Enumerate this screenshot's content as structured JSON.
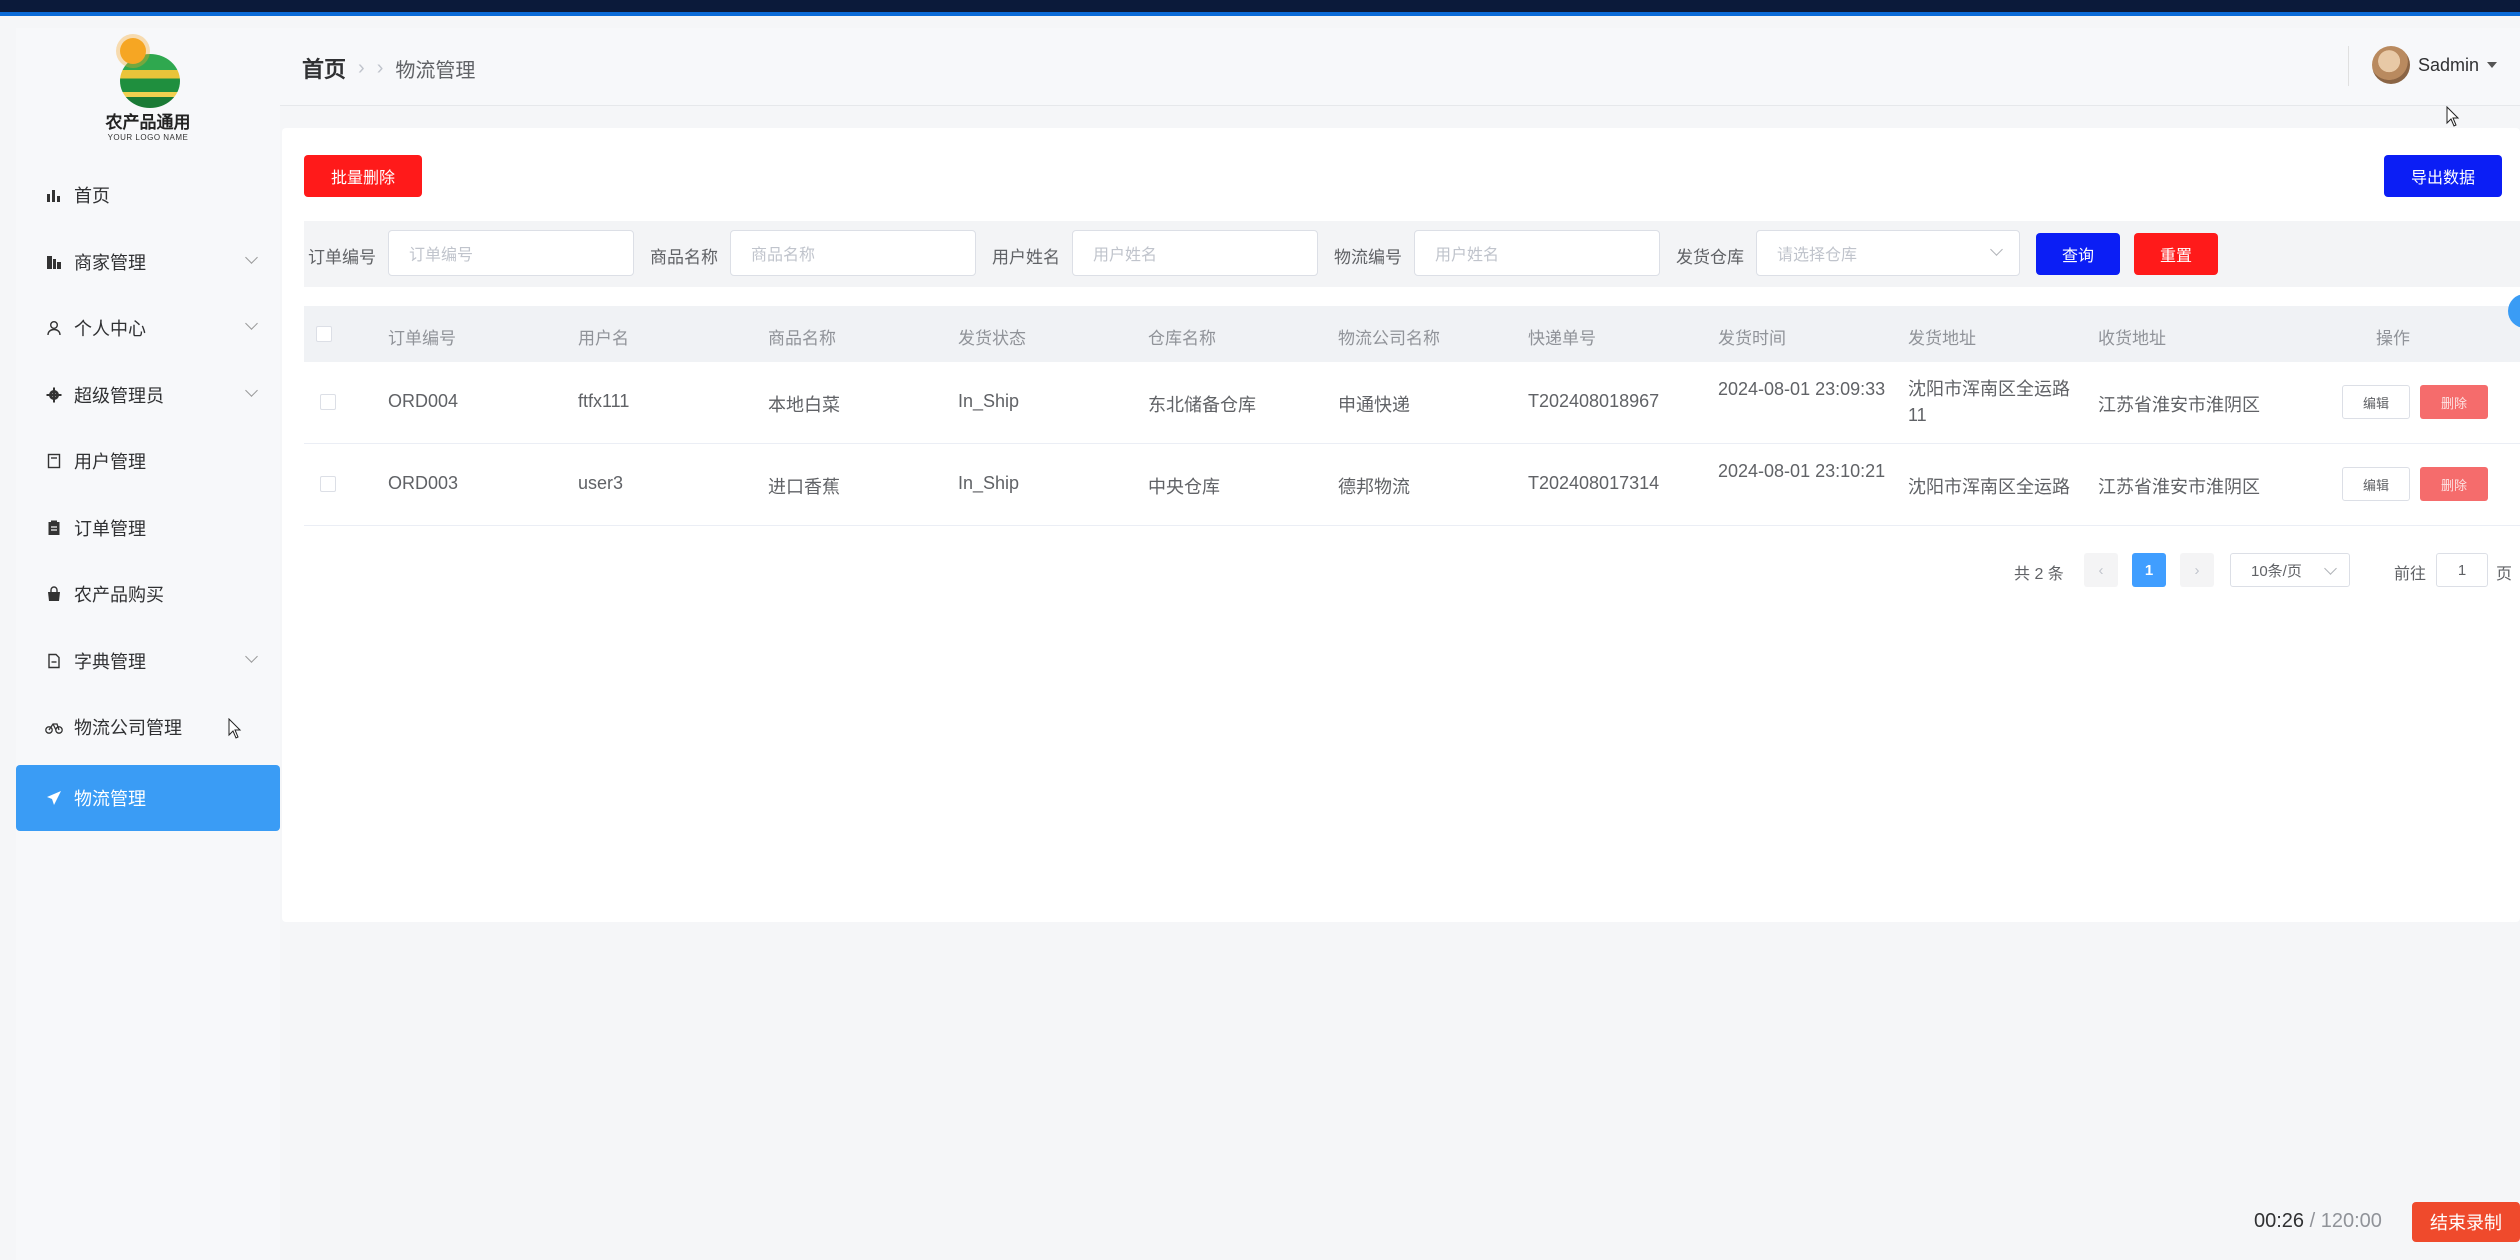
{
  "app": {
    "logo_title": "农产品通用",
    "logo_subtitle": "YOUR LOGO NAME"
  },
  "sidebar": {
    "items": [
      {
        "label": "首页",
        "icon": "bar-chart-icon",
        "expandable": false
      },
      {
        "label": "商家管理",
        "icon": "building-icon",
        "expandable": true
      },
      {
        "label": "个人中心",
        "icon": "user-icon",
        "expandable": true
      },
      {
        "label": "超级管理员",
        "icon": "gear-icon",
        "expandable": true
      },
      {
        "label": "用户管理",
        "icon": "document-icon",
        "expandable": false
      },
      {
        "label": "订单管理",
        "icon": "clipboard-icon",
        "expandable": false
      },
      {
        "label": "农产品购买",
        "icon": "shopping-bag-icon",
        "expandable": false
      },
      {
        "label": "字典管理",
        "icon": "file-icon",
        "expandable": true
      },
      {
        "label": "物流公司管理",
        "icon": "bicycle-icon",
        "expandable": false
      },
      {
        "label": "物流管理",
        "icon": "paper-plane-icon",
        "expandable": false,
        "active": true
      }
    ]
  },
  "header": {
    "breadcrumb_home": "首页",
    "breadcrumb_current": "物流管理",
    "username": "Sadmin"
  },
  "toolbar": {
    "batch_delete": "批量删除",
    "export": "导出数据"
  },
  "search": {
    "order_no_label": "订单编号",
    "order_no_placeholder": "订单编号",
    "product_label": "商品名称",
    "product_placeholder": "商品名称",
    "user_label": "用户姓名",
    "user_placeholder": "用户姓名",
    "logistics_label": "物流编号",
    "logistics_placeholder": "用户姓名",
    "warehouse_label": "发货仓库",
    "warehouse_placeholder": "请选择仓库",
    "query": "查询",
    "reset": "重置"
  },
  "table": {
    "columns": [
      "订单编号",
      "用户名",
      "商品名称",
      "发货状态",
      "仓库名称",
      "物流公司名称",
      "快递单号",
      "发货时间",
      "发货地址",
      "收货地址",
      "操作"
    ],
    "rows": [
      {
        "order_no": "ORD004",
        "username": "ftfx111",
        "product": "本地白菜",
        "status": "In_Ship",
        "warehouse": "东北储备仓库",
        "company": "申通快递",
        "tracking": "T202408018967",
        "time": "2024-08-01 23:09:33",
        "from": "沈阳市浑南区全运路11",
        "to": "江苏省淮安市淮阴区"
      },
      {
        "order_no": "ORD003",
        "username": "user3",
        "product": "进口香蕉",
        "status": "In_Ship",
        "warehouse": "中央仓库",
        "company": "德邦物流",
        "tracking": "T202408017314",
        "time": "2024-08-01 23:10:21",
        "from": "沈阳市浑南区全运路",
        "to": "江苏省淮安市淮阴区"
      }
    ],
    "edit_label": "编辑",
    "delete_label": "删除"
  },
  "pagination": {
    "total": "共 2 条",
    "current_page": "1",
    "page_size": "10条/页",
    "goto_label": "前往",
    "goto_value": "1",
    "page_suffix": "页"
  },
  "recorder": {
    "elapsed": "00:26",
    "total": "/ 120:00",
    "stop": "结束录制"
  },
  "colors": {
    "accent": "#3a9cf5",
    "danger": "#ff1a1a",
    "primary": "#0b1ef5",
    "record": "#ef4a2c"
  }
}
